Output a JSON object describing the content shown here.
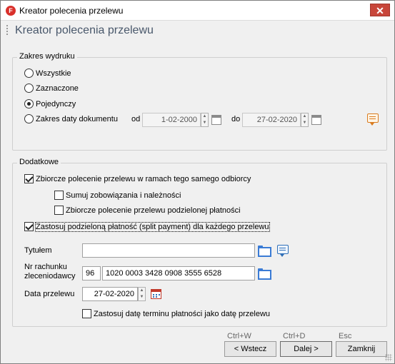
{
  "window": {
    "app_icon": "F",
    "title": "Kreator polecenia przelewu",
    "close_glyph": "✕"
  },
  "header": {
    "title": "Kreator polecenia przelewu"
  },
  "print_range": {
    "legend": "Zakres wydruku",
    "options": [
      {
        "label": "Wszystkie",
        "checked": false
      },
      {
        "label": "Zaznaczone",
        "checked": false
      },
      {
        "label": "Pojedynczy",
        "checked": true
      },
      {
        "label": "Zakres daty dokumentu",
        "checked": false
      }
    ],
    "from_label": "od",
    "from_value": "1-02-2000",
    "to_label": "do",
    "to_value": "27-02-2020"
  },
  "additional": {
    "legend": "Dodatkowe",
    "collective_transfer": {
      "label": "Zbiorcze polecenie przelewu w ramach tego samego odbiorcy",
      "checked": true
    },
    "sum_liabilities": {
      "label": "Sumuj zobowiązania i należności",
      "checked": false
    },
    "collective_split": {
      "label": "Zbiorcze polecenie przelewu podzielonej płatności",
      "checked": false
    },
    "split_payment": {
      "label": "Zastosuj podzieloną płatność (split payment) dla każdego przelewu",
      "checked": true
    },
    "title_label": "Tytułem",
    "title_value": "",
    "account_label_1": "Nr rachunku",
    "account_label_2": "zleceniodawcy",
    "account_prefix": "96",
    "account_number": "1020 0003 3428 0908 3555 6528",
    "date_label": "Data przelewu",
    "date_value": "27-02-2020",
    "use_due_date": {
      "label": "Zastosuj datę terminu płatności jako datę przelewu",
      "checked": false
    }
  },
  "footer": {
    "back": {
      "shortcut": "Ctrl+W",
      "label": "< Wstecz"
    },
    "next": {
      "shortcut": "Ctrl+D",
      "label": "Dalej >"
    },
    "close": {
      "shortcut": "Esc",
      "label": "Zamknij"
    }
  }
}
